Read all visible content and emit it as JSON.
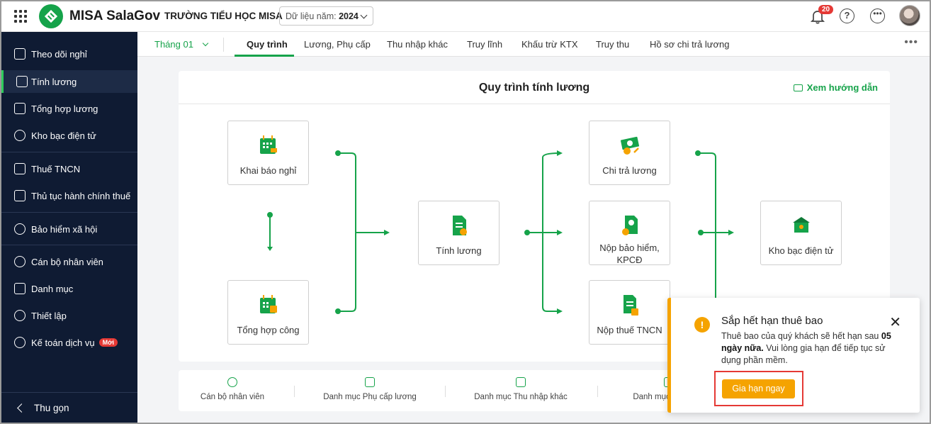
{
  "app": {
    "brand": "MISA SalaGov",
    "school": "TRƯỜNG TIỂU HỌC MISA",
    "year_prefix": "Dữ liệu năm:",
    "year_value": "2024",
    "notification_count": "20",
    "help_icon": "?",
    "more_icon": "•••"
  },
  "sidebar": {
    "items": [
      {
        "label": "Theo dõi nghỉ",
        "icon": "calendar-icon"
      },
      {
        "label": "Tính lương",
        "icon": "salary-doc-icon"
      },
      {
        "label": "Tổng hợp lương",
        "icon": "clipboard-icon"
      },
      {
        "label": "Kho bạc điện tử",
        "icon": "treasury-icon"
      },
      {
        "label": "Thuế TNCN",
        "icon": "tax-icon"
      },
      {
        "label": "Thủ tục hành chính thuế",
        "icon": "document-plus-icon"
      },
      {
        "label": "Bảo hiểm xã hội",
        "icon": "shield-icon"
      },
      {
        "label": "Cán bộ nhân viên",
        "icon": "people-icon"
      },
      {
        "label": "Danh mục",
        "icon": "list-icon"
      },
      {
        "label": "Thiết lập",
        "icon": "gear-icon"
      },
      {
        "label": "Kế toán dịch vụ",
        "icon": "compass-icon",
        "badge": "Mới"
      }
    ],
    "collapse_label": "Thu gọn"
  },
  "tabs": {
    "month": "Tháng 01",
    "items": [
      "Quy trình",
      "Lương, Phụ cấp",
      "Thu nhập khác",
      "Truy lĩnh",
      "Khấu trừ KTX",
      "Truy thu",
      "Hồ sơ chi trả lương"
    ],
    "more": "•••"
  },
  "process": {
    "title": "Quy trình tính lương",
    "guide_label": "Xem hướng dẫn",
    "steps": {
      "khai_bao_nghi": "Khai báo nghỉ",
      "tong_hop_cong": "Tổng hợp công",
      "tinh_luong": "Tính lương",
      "chi_tra_luong": "Chi trả lương",
      "nop_bao_hiem_1": "Nộp bảo hiểm,",
      "nop_bao_hiem_2": "KPCĐ",
      "nop_thue": "Nộp thuế TNCN",
      "kho_bac": "Kho bạc điện tử"
    },
    "accent": "#16a34a"
  },
  "shortcuts": [
    "Cán bộ nhân viên",
    "Danh mục Phụ cấp lương",
    "Danh mục Thu nhập khác",
    "Danh mục k"
  ],
  "notification": {
    "title": "Sắp hết hạn thuê bao",
    "body_1": "Thuê bao của quý khách sẽ hết hạn sau",
    "body_days": "05 ngày nữa.",
    "body_2": " Vui lòng gia hạn để tiếp tục sử dụng phần mềm.",
    "button": "Gia hạn ngay",
    "warning_color": "#f5a300"
  }
}
